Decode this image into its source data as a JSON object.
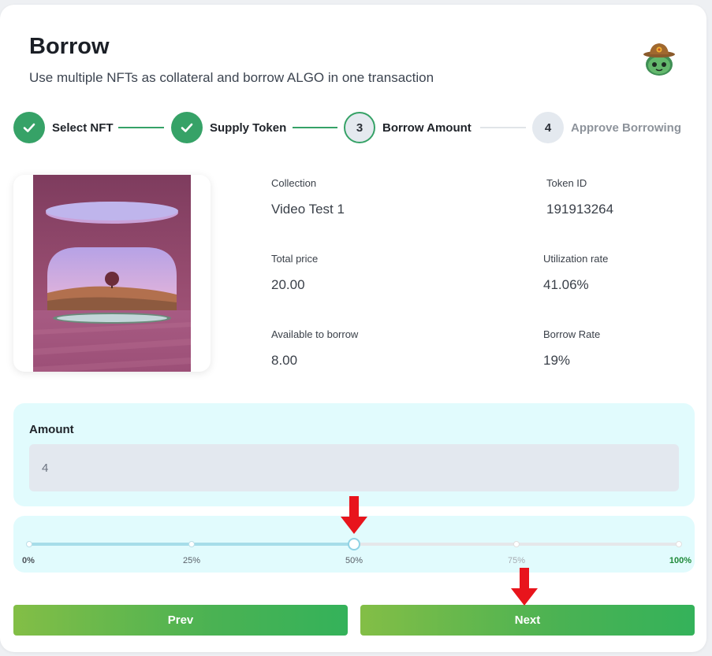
{
  "header": {
    "title": "Borrow",
    "subtitle": "Use multiple NFTs as collateral and borrow ALGO in one transaction",
    "avatar_icon": "cowboy-robot-avatar"
  },
  "steps": [
    {
      "label": "Select NFT",
      "status": "done",
      "icon": "check-icon"
    },
    {
      "label": "Supply Token",
      "status": "done",
      "icon": "check-icon"
    },
    {
      "number": "3",
      "label": "Borrow Amount",
      "status": "current"
    },
    {
      "number": "4",
      "label": "Approve Borrowing",
      "status": "todo"
    }
  ],
  "nft": {
    "image": "surreal-pink-room-with-tree-art",
    "collection_label": "Collection",
    "collection_value": "Video Test 1",
    "token_id_label": "Token ID",
    "token_id_value": "191913264",
    "total_price_label": "Total price",
    "total_price_value": "20.00",
    "utilization_label": "Utilization rate",
    "utilization_value": "41.06%",
    "available_label": "Available to borrow",
    "available_value": "8.00",
    "borrow_rate_label": "Borrow Rate",
    "borrow_rate_value": "19%"
  },
  "amount": {
    "label": "Amount",
    "value": "4"
  },
  "slider": {
    "value_percent": 50,
    "marks": [
      "0%",
      "25%",
      "50%",
      "75%",
      "100%"
    ]
  },
  "buttons": {
    "prev": "Prev",
    "next": "Next"
  },
  "colors": {
    "accent_green": "#36a267",
    "panel_bg": "#e1fbfd",
    "annotation_arrow": "#e8141c"
  }
}
